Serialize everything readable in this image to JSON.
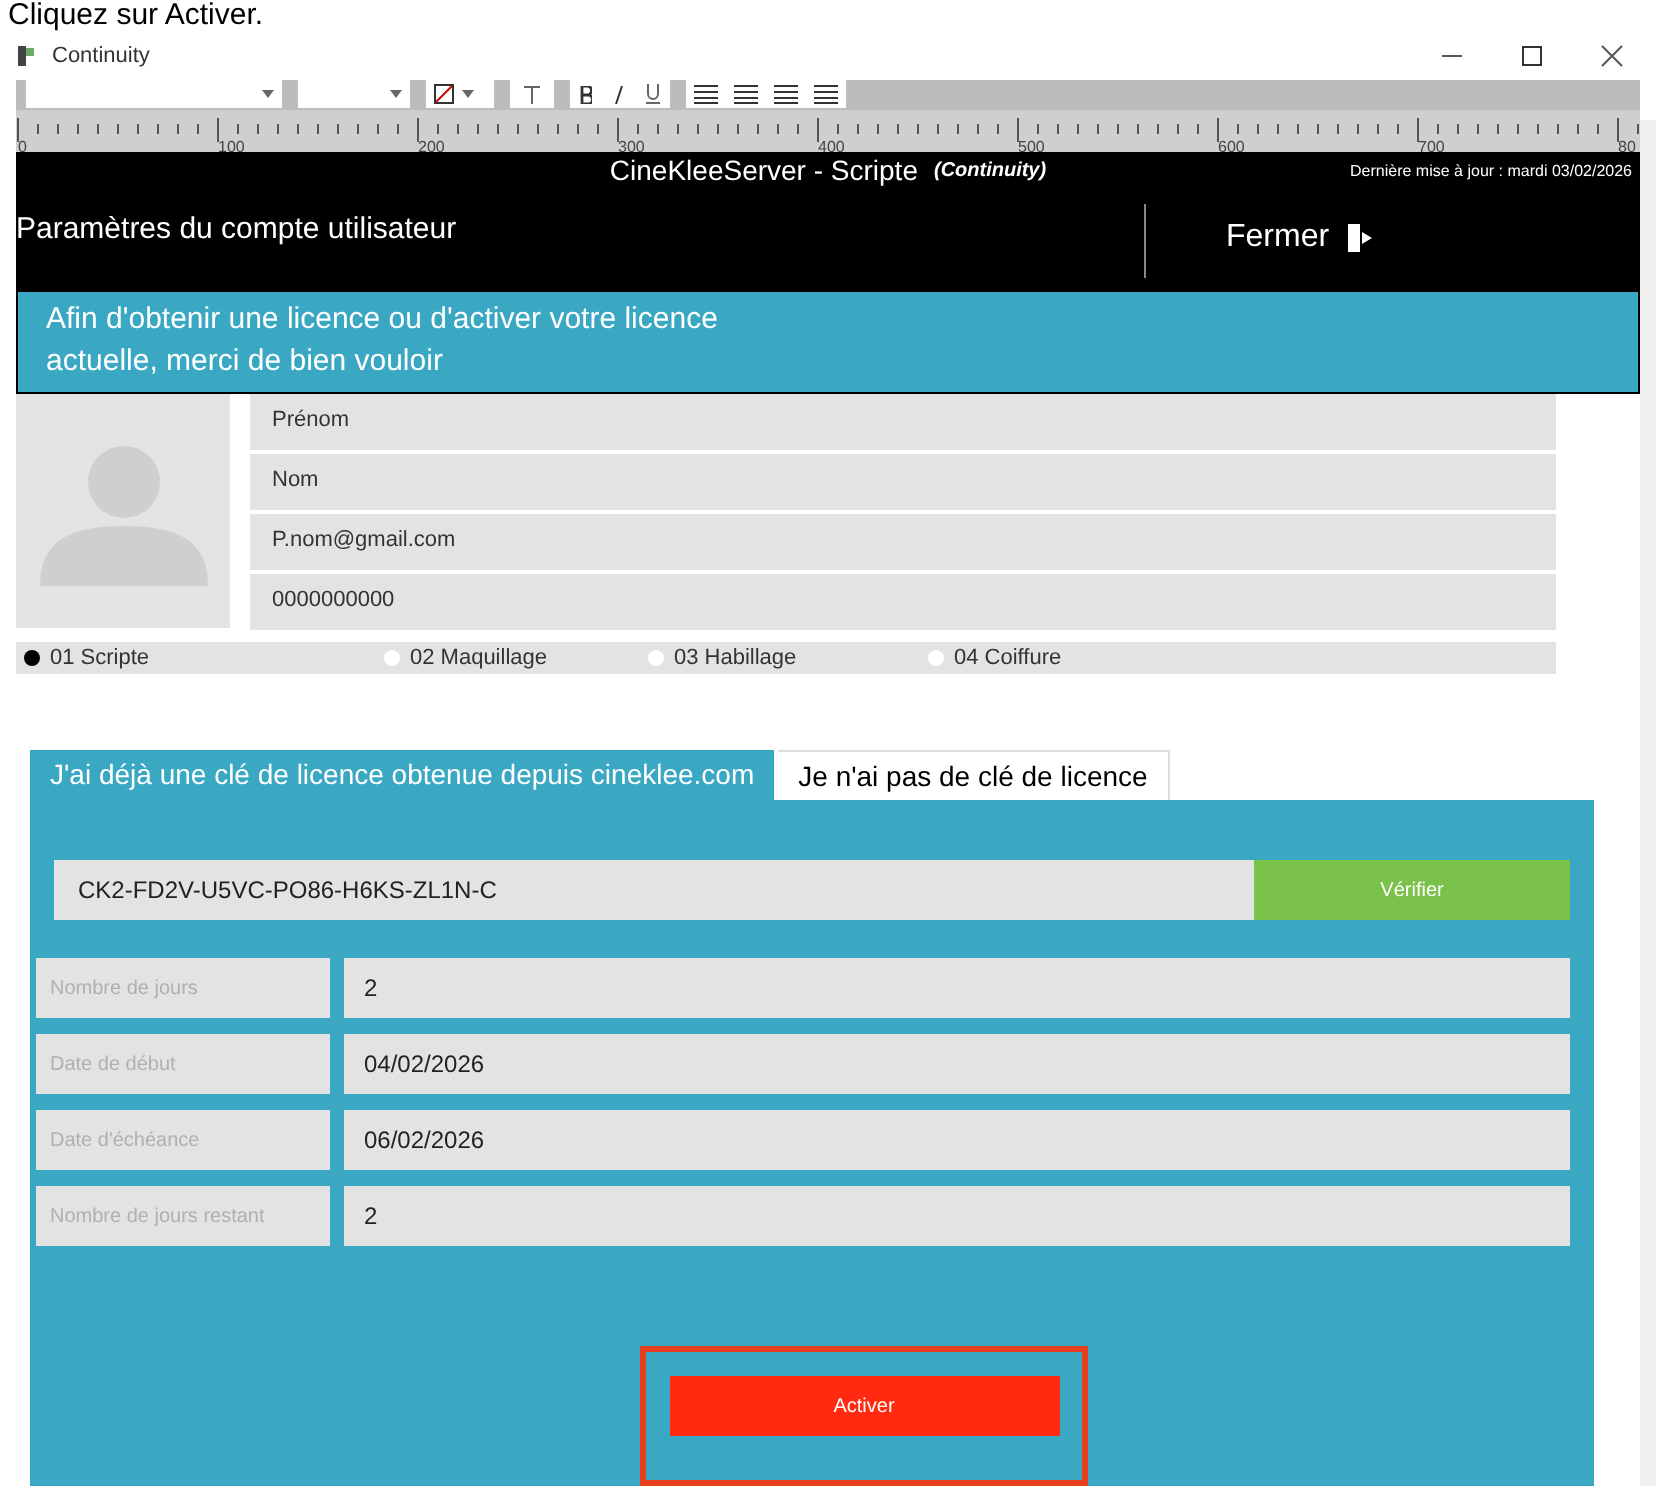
{
  "caption": "Cliquez sur Activer.",
  "window": {
    "title": "Continuity"
  },
  "ruler": {
    "marks": [
      "0",
      "100",
      "200",
      "300",
      "400",
      "500",
      "600",
      "700",
      "80"
    ]
  },
  "header": {
    "app_title": "CineKleeServer - Scripte",
    "app_subtitle": "(Continuity)",
    "last_update": "Dernière mise à jour : mardi 03/02/2026",
    "section_title": "Paramètres du compte utilisateur",
    "close_button": "Fermer"
  },
  "banner": {
    "text": "Afin d'obtenir une licence ou d'activer votre licence actuelle, merci de bien vouloir"
  },
  "profile": {
    "fields": [
      {
        "value": "Prénom"
      },
      {
        "value": "Nom"
      },
      {
        "value": "P.nom@gmail.com"
      },
      {
        "value": "0000000000"
      }
    ]
  },
  "roles": [
    {
      "label": "01  Scripte",
      "selected": true
    },
    {
      "label": "02  Maquillage",
      "selected": false
    },
    {
      "label": "03  Habillage",
      "selected": false
    },
    {
      "label": "04  Coiffure",
      "selected": false
    }
  ],
  "tabs": [
    {
      "label": "J'ai déjà une clé de licence obtenue depuis cineklee.com",
      "selected": true
    },
    {
      "label": "Je n'ai pas de clé de licence",
      "selected": false
    }
  ],
  "license": {
    "key": "CK2-FD2V-U5VC-PO86-H6KS-ZL1N-C",
    "verify_button": "Vérifier",
    "rows": [
      {
        "label": "Nombre de jours",
        "value": "2"
      },
      {
        "label": "Date de début",
        "value": "04/02/2026"
      },
      {
        "label": "Date d'échéance",
        "value": "06/02/2026"
      },
      {
        "label": "Nombre de jours restant",
        "value": "2"
      }
    ],
    "activate_button": "Activer"
  }
}
